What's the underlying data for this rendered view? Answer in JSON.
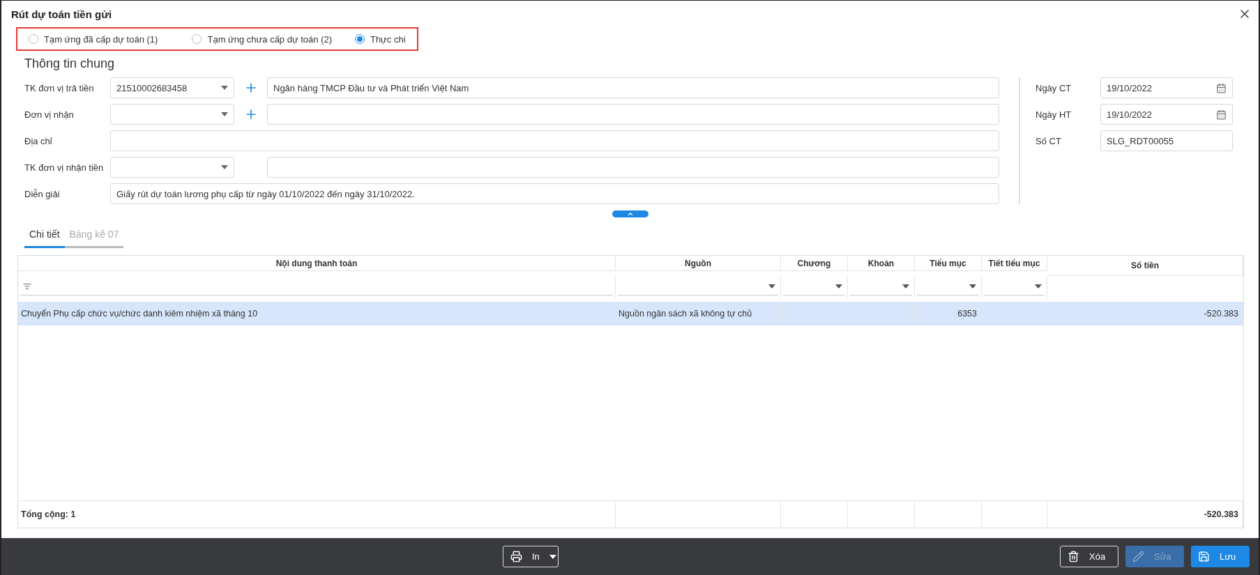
{
  "dialog": {
    "title": "Rút dự toán tiền gửi"
  },
  "voucher_types": [
    {
      "label": "Tạm ứng đã cấp dự toán (1)",
      "selected": false
    },
    {
      "label": "Tạm ứng chưa cấp dự toán (2)",
      "selected": false
    },
    {
      "label": "Thực chi",
      "selected": true
    }
  ],
  "section_title": "Thông tin chung",
  "left_fields": [
    {
      "kind": "combo_add",
      "label": "TK đơn vị trả tiền",
      "value": "21510002683458",
      "detail": "Ngân hàng TMCP Đầu tư và Phát triển Việt Nam"
    },
    {
      "kind": "combo_add",
      "label": "Đơn vị nhận"
    },
    {
      "kind": "text",
      "label": "Địa chỉ"
    },
    {
      "kind": "combo_text",
      "label": "TK đơn vị nhận tiền"
    },
    {
      "kind": "text",
      "label": "Diễn giải",
      "value": "Giấy rút dự toán lương phụ cấp từ ngày 01/10/2022 đến ngày 31/10/2022."
    }
  ],
  "right_fields": [
    {
      "kind": "date",
      "label": "Ngày CT",
      "value": "19/10/2022"
    },
    {
      "kind": "date",
      "label": "Ngày HT",
      "value": "19/10/2022"
    },
    {
      "kind": "text",
      "label": "Số CT",
      "value": "SLG_RDT00055"
    }
  ],
  "tabs": [
    {
      "label": "Chi tiết",
      "selected": true
    },
    {
      "label": "Bảng kê 07",
      "selected": false
    }
  ],
  "table": {
    "columns": [
      {
        "label": "Nội dung thanh toán",
        "kind": "text"
      },
      {
        "label": "Nguồn",
        "kind": "list"
      },
      {
        "label": "Chương",
        "kind": "list"
      },
      {
        "label": "Khoản",
        "kind": "list"
      },
      {
        "label": "Tiểu mục",
        "kind": "code"
      },
      {
        "label": "Tiết tiểu mục",
        "kind": "list"
      },
      {
        "label": "Số tiền",
        "kind": "amount"
      }
    ],
    "rows": [
      {
        "selected": true,
        "cells": [
          "Chuyển Phụ cấp chức vụ/chức danh kiêm nhiệm xã tháng 10",
          "Nguồn ngân sách xã không tự chủ",
          null,
          null,
          "6353",
          null,
          "-520.383"
        ]
      }
    ],
    "footer": {
      "label": "Tổng cộng: 1",
      "total": "-520.383"
    }
  },
  "actions": [
    {
      "kind": "print",
      "label": "In",
      "disabled": false
    },
    {
      "kind": "delete",
      "label": "Xóa",
      "disabled": false
    },
    {
      "kind": "edit",
      "label": "Sửa",
      "disabled": true
    },
    {
      "kind": "save",
      "label": "Lưu",
      "disabled": false
    }
  ]
}
